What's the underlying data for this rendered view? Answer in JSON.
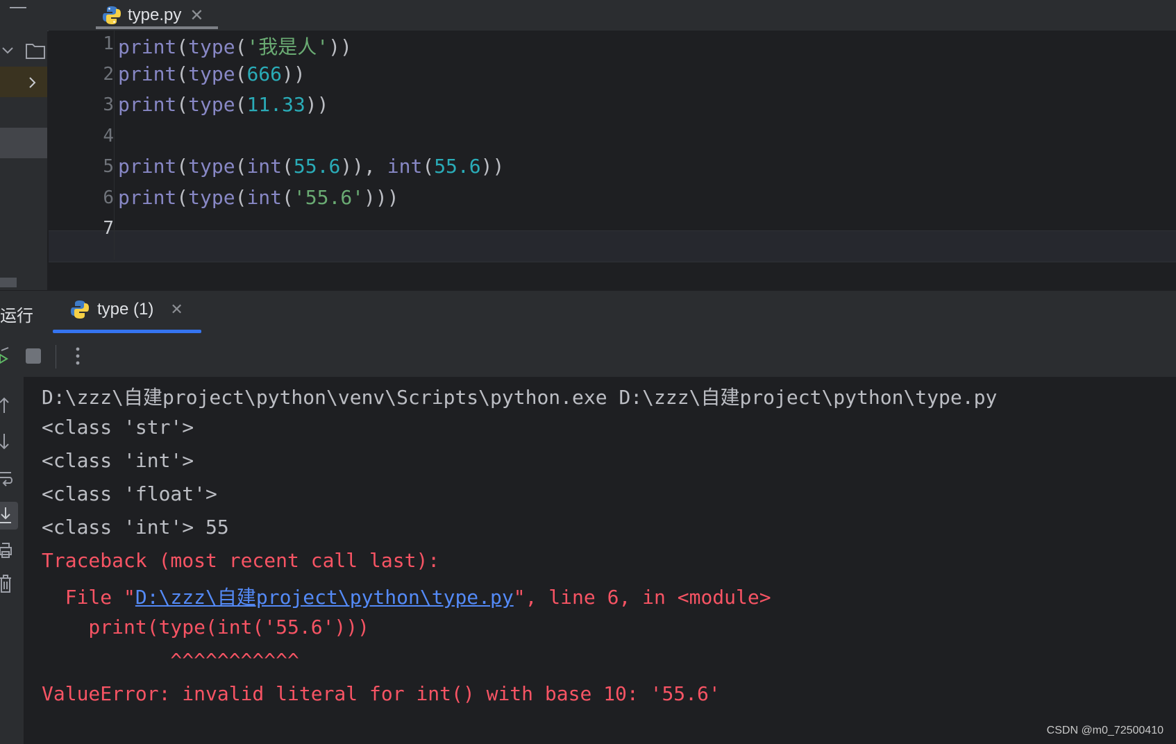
{
  "editor": {
    "tab_label": "type.py",
    "line_numbers": [
      "1",
      "2",
      "3",
      "4",
      "5",
      "6",
      "7"
    ],
    "lines": [
      {
        "p1": "print",
        "p2": "(",
        "p3": "type",
        "p4": "(",
        "p5": "'我是人'",
        "p6": "))"
      },
      {
        "p1": "print",
        "p2": "(",
        "p3": "type",
        "p4": "(",
        "p5": "666",
        "p6": "))"
      },
      {
        "p1": "print",
        "p2": "(",
        "p3": "type",
        "p4": "(",
        "p5": "11.33",
        "p6": "))"
      },
      {},
      {
        "p1": "print",
        "p2": "(",
        "p3": "type",
        "p4": "(",
        "p5": "int",
        "p6": "(",
        "p7": "55.6",
        "p8": ")), ",
        "p9": "int",
        "p10": "(",
        "p11": "55.6",
        "p12": "))"
      },
      {
        "p1": "print",
        "p2": "(",
        "p3": "type",
        "p4": "(",
        "p5": "int",
        "p6": "(",
        "p7": "'55.6'",
        "p8": ")))"
      },
      {}
    ]
  },
  "run": {
    "title": "运行",
    "tab_label": "type (1)"
  },
  "console": {
    "cmd": "D:\\zzz\\自建project\\python\\venv\\Scripts\\python.exe D:\\zzz\\自建project\\python\\type.py",
    "out1": "<class 'str'>",
    "out2": "<class 'int'>",
    "out3": "<class 'float'>",
    "out4": "<class 'int'> 55",
    "traceback": "Traceback (most recent call last):",
    "file_prefix": "  File \"",
    "file_link": "D:\\zzz\\自建project\\python\\type.py",
    "file_suffix": "\", line 6, in <module>",
    "code_line": "    print(type(int('55.6')))",
    "carets": "           ^^^^^^^^^^^",
    "error": "ValueError: invalid literal for int() with base 10: '55.6'"
  },
  "watermark": "CSDN @m0_72500410",
  "colors": {
    "background": "#1e1f22",
    "panel": "#2b2d30",
    "keyword": "#8888c6",
    "string": "#6aab73",
    "number": "#2aacb8",
    "error": "#f75464",
    "link": "#548af7",
    "accent": "#3574f0"
  }
}
